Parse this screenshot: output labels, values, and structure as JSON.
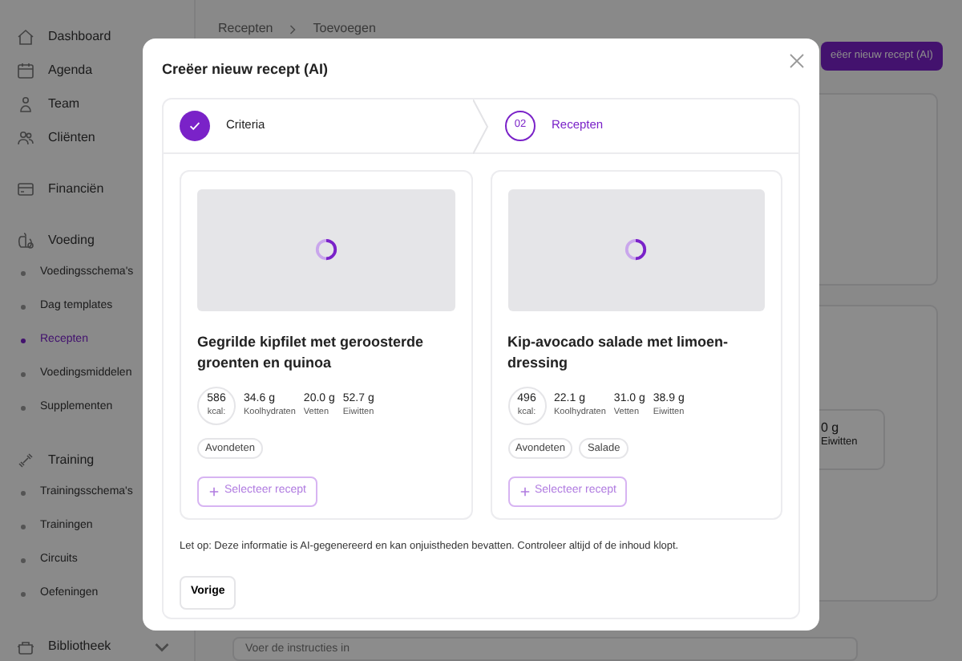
{
  "sidebar": {
    "sections": [
      [
        {
          "label": "Dashboard"
        },
        {
          "label": "Agenda"
        },
        {
          "label": "Team"
        },
        {
          "label": "Cliënten"
        }
      ],
      [
        {
          "label": "Financiën"
        }
      ],
      [
        {
          "label": "Voeding",
          "children": [
            {
              "label": "Voedingsschema's",
              "selected": false
            },
            {
              "label": "Dag templates",
              "selected": false
            },
            {
              "label": "Recepten",
              "selected": true
            },
            {
              "label": "Voedingsmiddelen",
              "selected": false
            },
            {
              "label": "Supplementen",
              "selected": false
            }
          ]
        }
      ],
      [
        {
          "label": "Training",
          "children": [
            {
              "label": "Trainingsschema's",
              "selected": false
            },
            {
              "label": "Trainingen",
              "selected": false
            },
            {
              "label": "Circuits",
              "selected": false
            },
            {
              "label": "Oefeningen",
              "selected": false
            }
          ]
        }
      ],
      [
        {
          "label": "Bibliotheek",
          "expandable": true
        }
      ]
    ]
  },
  "breadcrumb": [
    "Recepten",
    "Toevoegen"
  ],
  "header_button": "eëer nieuw recept (AI)",
  "background": {
    "macro_value": "0 g",
    "macro_label": "Eiwitten",
    "instructions_placeholder": "Voer de instructies in"
  },
  "modal": {
    "title": "Creëer nieuw recept (AI)",
    "steps": [
      {
        "label": "Criteria",
        "done": true,
        "selected": false
      },
      {
        "number": "02",
        "label": "Recepten",
        "done": false,
        "selected": true
      }
    ],
    "recipes": [
      {
        "title": "Gegrilde kipfilet met geroosterde groenten en quinoa",
        "kcal": "586",
        "kcal_unit": "kcal:",
        "macros": [
          {
            "value": "34.6 g",
            "label": "Koolhydraten"
          },
          {
            "value": "20.0 g",
            "label": "Vetten"
          },
          {
            "value": "52.7 g",
            "label": "Eiwitten"
          }
        ],
        "tags": [
          "Avondeten"
        ],
        "button": "Selecteer recept"
      },
      {
        "title": "Kip-avocado salade met limoen-dressing",
        "kcal": "496",
        "kcal_unit": "kcal:",
        "macros": [
          {
            "value": "22.1 g",
            "label": "Koolhydraten"
          },
          {
            "value": "31.0 g",
            "label": "Vetten"
          },
          {
            "value": "38.9 g",
            "label": "Eiwitten"
          }
        ],
        "tags": [
          "Avondeten",
          "Salade"
        ],
        "button": "Selecteer recept"
      }
    ],
    "note": "Let op: Deze informatie is AI-gegenereerd en kan onjuistheden bevatten. Controleer altijd of de inhoud klopt.",
    "back_button": "Vorige"
  }
}
